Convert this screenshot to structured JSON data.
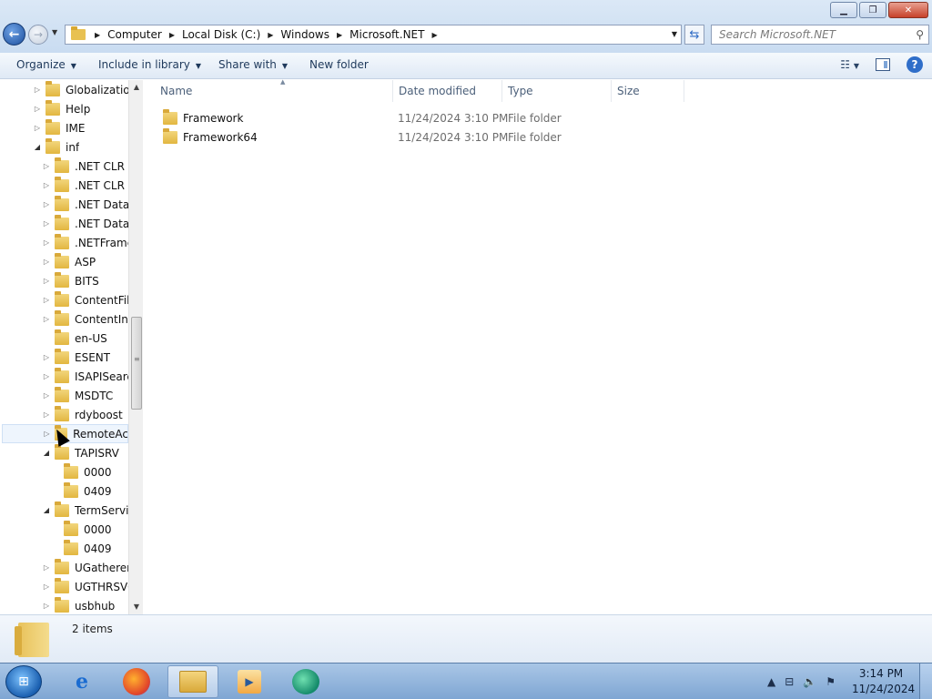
{
  "window": {
    "minimize_icon": "minimize-icon",
    "maximize_icon": "restore-icon",
    "close_icon": "close-icon"
  },
  "address": {
    "crumbs": [
      "Computer",
      "Local Disk (C:)",
      "Windows",
      "Microsoft.NET"
    ],
    "search_placeholder": "Search Microsoft.NET"
  },
  "toolbar": {
    "organize": "Organize",
    "include_in_library": "Include in library",
    "share_with": "Share with",
    "new_folder": "New folder"
  },
  "tree": {
    "items": [
      {
        "label": "Globalization",
        "level": 0,
        "expander": "collapsed"
      },
      {
        "label": "Help",
        "level": 0,
        "expander": "collapsed"
      },
      {
        "label": "IME",
        "level": 0,
        "expander": "collapsed"
      },
      {
        "label": "inf",
        "level": 0,
        "expander": "expanded"
      },
      {
        "label": ".NET CLR D",
        "level": 1,
        "expander": "collapsed"
      },
      {
        "label": ".NET CLR N",
        "level": 1,
        "expander": "collapsed"
      },
      {
        "label": ".NET Data F",
        "level": 1,
        "expander": "collapsed"
      },
      {
        "label": ".NET Data F",
        "level": 1,
        "expander": "collapsed"
      },
      {
        "label": ".NETFrame",
        "level": 1,
        "expander": "collapsed"
      },
      {
        "label": "ASP",
        "level": 1,
        "expander": "collapsed"
      },
      {
        "label": "BITS",
        "level": 1,
        "expander": "collapsed"
      },
      {
        "label": "ContentFilt",
        "level": 1,
        "expander": "collapsed"
      },
      {
        "label": "ContentInd",
        "level": 1,
        "expander": "collapsed"
      },
      {
        "label": "en-US",
        "level": 1,
        "expander": "none"
      },
      {
        "label": "ESENT",
        "level": 1,
        "expander": "collapsed"
      },
      {
        "label": "ISAPISearch",
        "level": 1,
        "expander": "collapsed"
      },
      {
        "label": "MSDTC",
        "level": 1,
        "expander": "collapsed"
      },
      {
        "label": "rdyboost",
        "level": 1,
        "expander": "collapsed"
      },
      {
        "label": "RemoteAcc",
        "level": 1,
        "expander": "collapsed",
        "hover": true
      },
      {
        "label": "TAPISRV",
        "level": 1,
        "expander": "expanded"
      },
      {
        "label": "0000",
        "level": 2,
        "expander": "none"
      },
      {
        "label": "0409",
        "level": 2,
        "expander": "none"
      },
      {
        "label": "TermServic",
        "level": 1,
        "expander": "expanded"
      },
      {
        "label": "0000",
        "level": 2,
        "expander": "none"
      },
      {
        "label": "0409",
        "level": 2,
        "expander": "none"
      },
      {
        "label": "UGatherer",
        "level": 1,
        "expander": "collapsed"
      },
      {
        "label": "UGTHRSVC",
        "level": 1,
        "expander": "collapsed"
      },
      {
        "label": "usbhub",
        "level": 1,
        "expander": "collapsed"
      }
    ]
  },
  "columns": {
    "name": "Name",
    "date_modified": "Date modified",
    "type": "Type",
    "size": "Size"
  },
  "files": [
    {
      "name": "Framework",
      "date": "11/24/2024 3:10 PM",
      "type": "File folder"
    },
    {
      "name": "Framework64",
      "date": "11/24/2024 3:10 PM",
      "type": "File folder"
    }
  ],
  "details": {
    "items_count": "2 items"
  },
  "taskbar": {
    "apps": [
      "internet-explorer-icon",
      "firefox-icon",
      "windows-explorer-icon",
      "media-player-icon",
      "green-app-icon"
    ],
    "time": "3:14 PM",
    "date": "11/24/2024"
  }
}
